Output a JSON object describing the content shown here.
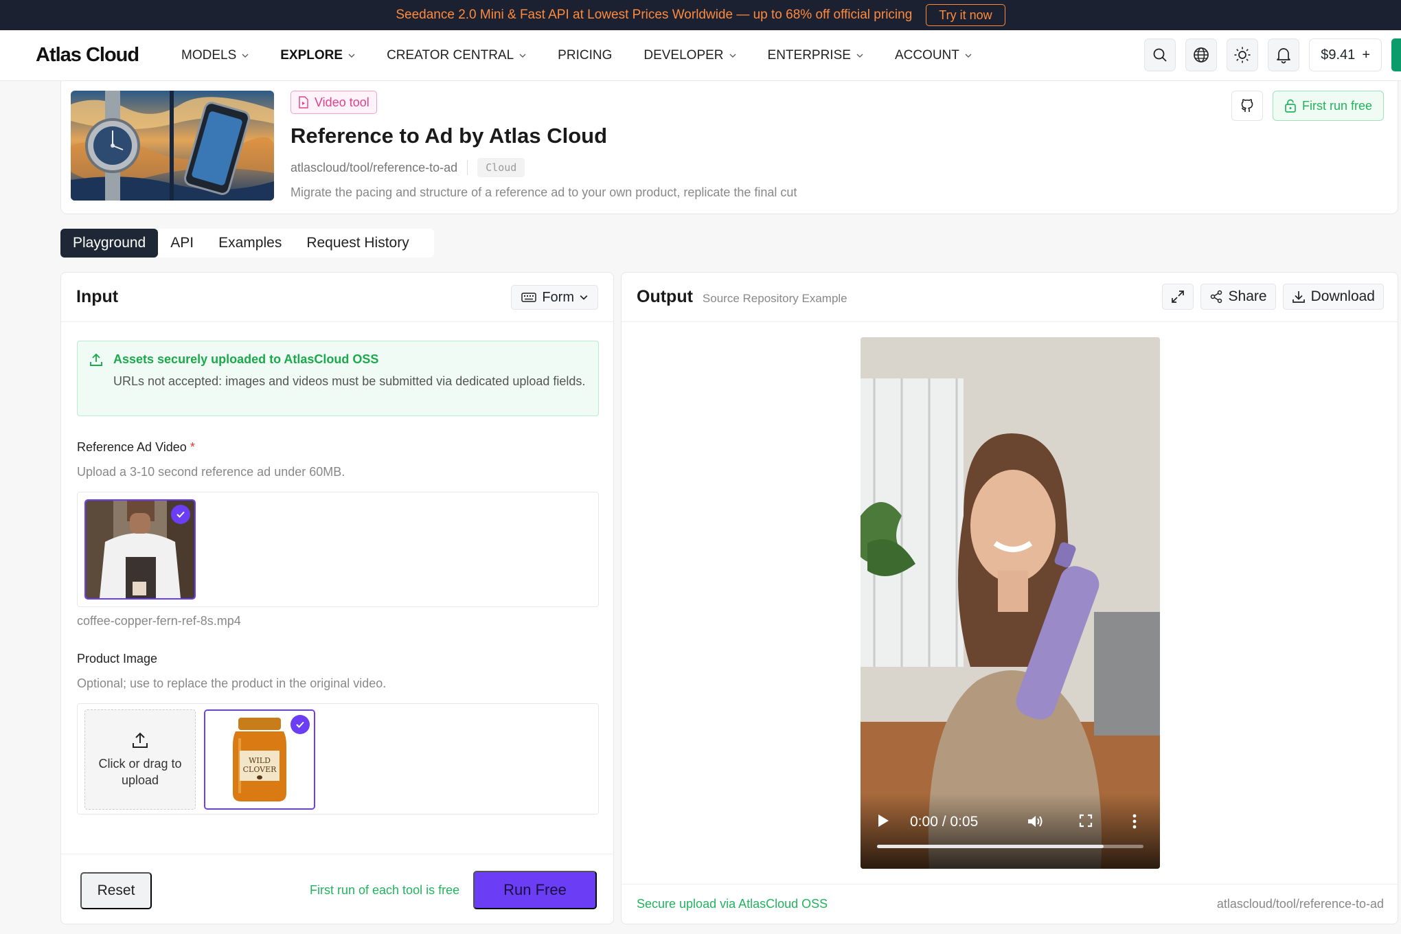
{
  "promo": {
    "text": "Seedance 2.0 Mini & Fast API at Lowest Prices Worldwide — up to 68% off official pricing",
    "cta": "Try it now"
  },
  "nav": {
    "logo": "Atlas Cloud",
    "items": [
      {
        "label": "MODELS",
        "dropdown": true
      },
      {
        "label": "EXPLORE",
        "dropdown": true,
        "active": true
      },
      {
        "label": "CREATOR CENTRAL",
        "dropdown": true
      },
      {
        "label": "PRICING",
        "dropdown": false
      },
      {
        "label": "DEVELOPER",
        "dropdown": true
      },
      {
        "label": "ENTERPRISE",
        "dropdown": true
      },
      {
        "label": "ACCOUNT",
        "dropdown": true
      }
    ],
    "icons": [
      "search-icon",
      "globe-icon",
      "sun-icon",
      "bell-icon"
    ],
    "balance": "$9.41",
    "balance_add": "+"
  },
  "tool": {
    "tag": "Video tool",
    "title": "Reference to Ad by Atlas Cloud",
    "slug": "atlascloud/tool/reference-to-ad",
    "chip": "Cloud",
    "description": "Migrate the pacing and structure of a reference ad to your own product, replicate the final cut",
    "first_run": "First run free"
  },
  "tabs": [
    "Playground",
    "API",
    "Examples",
    "Request History"
  ],
  "input": {
    "title": "Input",
    "mode": "Form",
    "notice_title": "Assets securely uploaded to AtlasCloud OSS",
    "notice_body": "URLs not accepted: images and videos must be submitted via dedicated upload fields.",
    "ref_label": "Reference Ad Video",
    "ref_required": "*",
    "ref_hint": "Upload a 3-10 second reference ad under 60MB.",
    "ref_file": "coffee-copper-fern-ref-8s.mp4",
    "prod_label": "Product Image",
    "prod_hint": "Optional; use to replace the product in the original video.",
    "upload_text": "Click or drag to upload",
    "jar_label_1": "WILD",
    "jar_label_2": "CLOVER",
    "reset": "Reset",
    "free_note": "First run of each tool is free",
    "run": "Run Free"
  },
  "output": {
    "title": "Output",
    "subtitle": "Source Repository Example",
    "share": "Share",
    "download": "Download",
    "time": "0:00 / 0:05",
    "progress": 0.85,
    "foot_left": "Secure upload via AtlasCloud OSS",
    "foot_right": "atlascloud/tool/reference-to-ad"
  },
  "colors": {
    "accent": "#6b3ef5",
    "success": "#22b35e",
    "promo": "#ff8a3d",
    "dark": "#1e2735"
  }
}
